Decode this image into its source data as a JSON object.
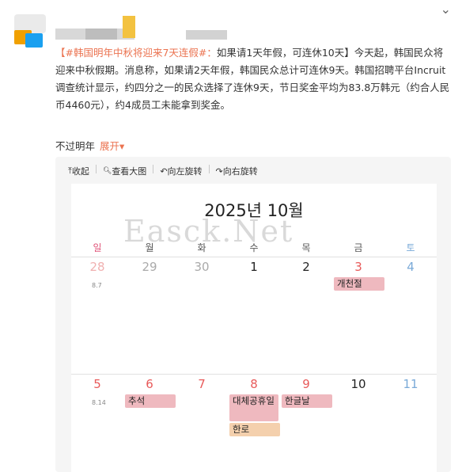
{
  "post": {
    "hashtag": "【#韩国明年中秋将迎来7天连假#：",
    "body": "如果请1天年假，可连休10天】今天起，韩国民众将迎来中秋假期。消息称，如果请2天年假，韩国民众总计可连休9天。韩国招聘平台Incruit调查统计显示，约四分之一的民众选择了连休9天，节日奖金平均为83.8万韩元（约合人民币4460元），约4成员工未能拿到奖金。",
    "footer_text": "不过明年",
    "expand_label": "展开",
    "expand_icon": "▾"
  },
  "toolbar": {
    "items": [
      {
        "icon": "⤒",
        "label": "收起"
      },
      {
        "icon": "🔍",
        "label": "查看大图"
      },
      {
        "icon": "↶",
        "label": "向左旋转"
      },
      {
        "icon": "↷",
        "label": "向右旋转"
      }
    ]
  },
  "calendar": {
    "title": "2025년 10월",
    "watermark": "Easck.Net",
    "weekdays": [
      "일",
      "월",
      "화",
      "수",
      "목",
      "금",
      "토"
    ],
    "weekday_colors": [
      "#e0557a",
      "#555555",
      "#555555",
      "#555555",
      "#555555",
      "#555555",
      "#7aaad8"
    ],
    "week1": {
      "days": [
        "28",
        "29",
        "30",
        "1",
        "2",
        "3",
        "4"
      ],
      "sub_sunday": "8.7",
      "events": [
        {
          "col": 5,
          "label": "개천절",
          "color": "red"
        }
      ]
    },
    "week2": {
      "days": [
        "5",
        "6",
        "7",
        "8",
        "9",
        "10",
        "11"
      ],
      "sub_sunday": "8.14",
      "events": [
        {
          "col": 1,
          "label": "추석",
          "color": "red"
        },
        {
          "col": 3,
          "label": "대체공휴일",
          "color": "red"
        },
        {
          "col": 4,
          "label": "한글날",
          "color": "red"
        },
        {
          "col": 3,
          "label": "한로",
          "color": "peach"
        }
      ]
    }
  },
  "colors": {
    "hashtag": "#eb7350",
    "holiday_red": "#e85a5a",
    "saturday_blue": "#7aaad8",
    "event_red_bg": "#efb9bf",
    "event_peach_bg": "#f4d0ad"
  }
}
